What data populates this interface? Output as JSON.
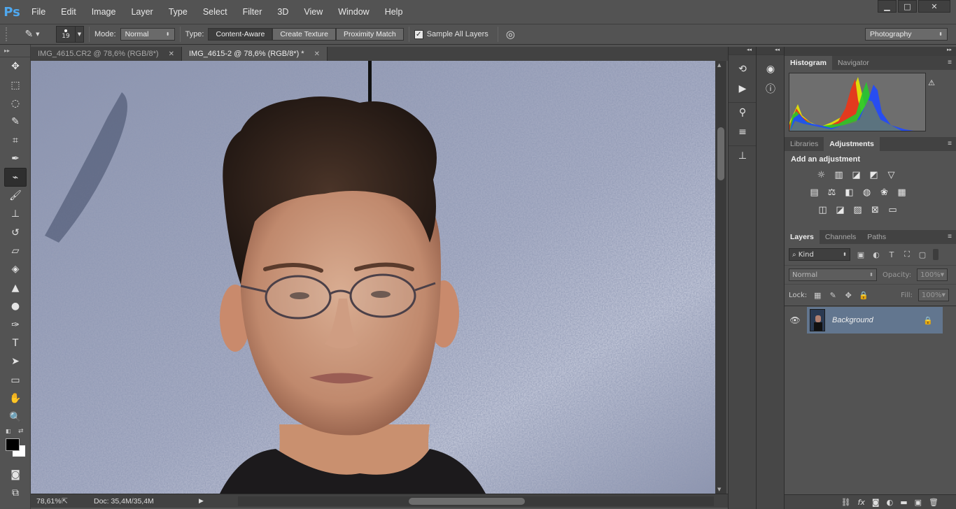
{
  "app": {
    "logo": "Ps"
  },
  "menu": [
    "File",
    "Edit",
    "Image",
    "Layer",
    "Type",
    "Select",
    "Filter",
    "3D",
    "View",
    "Window",
    "Help"
  ],
  "window_controls": {
    "minimize": "▁",
    "maximize": "□",
    "close": "✕"
  },
  "options": {
    "brush_size": "19",
    "mode_label": "Mode:",
    "mode_value": "Normal",
    "type_label": "Type:",
    "types": [
      "Content-Aware",
      "Create Texture",
      "Proximity Match"
    ],
    "active_type": "Content-Aware",
    "sample_all_layers": "Sample All Layers",
    "sample_all_checked": true,
    "workspace": "Photography"
  },
  "tabs": [
    {
      "label": "IMG_4615.CR2 @ 78,6% (RGB/8*)",
      "active": false
    },
    {
      "label": "IMG_4615-2 @ 78,6% (RGB/8*) *",
      "active": true
    }
  ],
  "tools": [
    "move-tool-icon",
    "marquee-tool-icon",
    "lasso-tool-icon",
    "quick-select-tool-icon",
    "crop-tool-icon",
    "eyedropper-tool-icon",
    "spot-healing-tool-icon",
    "brush-tool-icon",
    "clone-stamp-tool-icon",
    "history-brush-tool-icon",
    "eraser-tool-icon",
    "paint-bucket-tool-icon",
    "blur-tool-icon",
    "dodge-tool-icon",
    "pen-tool-icon",
    "type-tool-icon",
    "path-select-tool-icon",
    "rectangle-tool-icon",
    "hand-tool-icon",
    "zoom-tool-icon"
  ],
  "status": {
    "zoom": "78,61%",
    "doc": "Doc: 35,4M/35,4M"
  },
  "panels": {
    "histogram_tabs": [
      "Histogram",
      "Navigator"
    ],
    "adjust_tabs": [
      "Libraries",
      "Adjustments"
    ],
    "adjust_title": "Add an adjustment",
    "layers_tabs": [
      "Layers",
      "Channels",
      "Paths"
    ],
    "kind": "Kind",
    "blend_mode": "Normal",
    "opacity_label": "Opacity:",
    "opacity_value": "100%",
    "lock_label": "Lock:",
    "fill_label": "Fill:",
    "fill_value": "100%",
    "layer_name": "Background"
  },
  "colors": {
    "accent": "#4fa8ef",
    "selection": "#62768f",
    "panel": "#535353",
    "dark": "#424242"
  }
}
